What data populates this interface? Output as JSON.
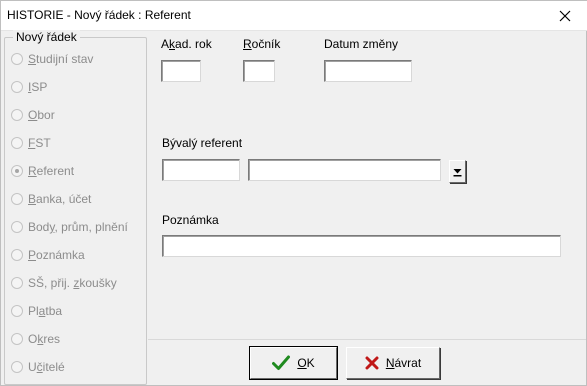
{
  "window": {
    "title": "HISTORIE -  Nový řádek : Referent",
    "close_glyph": "✕"
  },
  "group": {
    "legend": "Nový řádek",
    "options": [
      {
        "pre": "",
        "key": "S",
        "post": "tudijní stav",
        "checked": false
      },
      {
        "pre": "",
        "key": "I",
        "post": "SP",
        "checked": false
      },
      {
        "pre": "",
        "key": "O",
        "post": "bor",
        "checked": false
      },
      {
        "pre": "",
        "key": "F",
        "post": "ST",
        "checked": false
      },
      {
        "pre": "",
        "key": "R",
        "post": "eferent",
        "checked": true
      },
      {
        "pre": "",
        "key": "B",
        "post": "anka, účet",
        "checked": false
      },
      {
        "pre": "Bod",
        "key": "y",
        "post": ", prům, plnění",
        "checked": false
      },
      {
        "pre": "",
        "key": "P",
        "post": "oznámka",
        "checked": false
      },
      {
        "pre": "SŠ, přij. ",
        "key": "z",
        "post": "koušky",
        "checked": false
      },
      {
        "pre": "Pl",
        "key": "a",
        "post": "tba",
        "checked": false
      },
      {
        "pre": "O",
        "key": "k",
        "post": "res",
        "checked": false
      },
      {
        "pre": "U",
        "key": "č",
        "post": "itelé",
        "checked": false
      }
    ]
  },
  "form": {
    "akad_rok": {
      "pre": "A",
      "key": "k",
      "post": "ad. rok",
      "value": ""
    },
    "rocnik": {
      "pre": "",
      "key": "R",
      "post": "očník",
      "value": ""
    },
    "datum_zmeny": {
      "label": "Datum změny",
      "value": ""
    },
    "byvaly_referent": {
      "label": "Bývalý referent",
      "code": "",
      "name": ""
    },
    "poznamka": {
      "label": "Poznámka",
      "value": ""
    }
  },
  "buttons": {
    "ok": {
      "pre": "",
      "key": "O",
      "post": "K",
      "icon": "checkmark-icon",
      "icon_color": "#1f8a1f"
    },
    "back": {
      "pre": "",
      "key": "N",
      "post": "ávrat",
      "icon": "x-icon",
      "icon_color": "#c01818"
    }
  }
}
